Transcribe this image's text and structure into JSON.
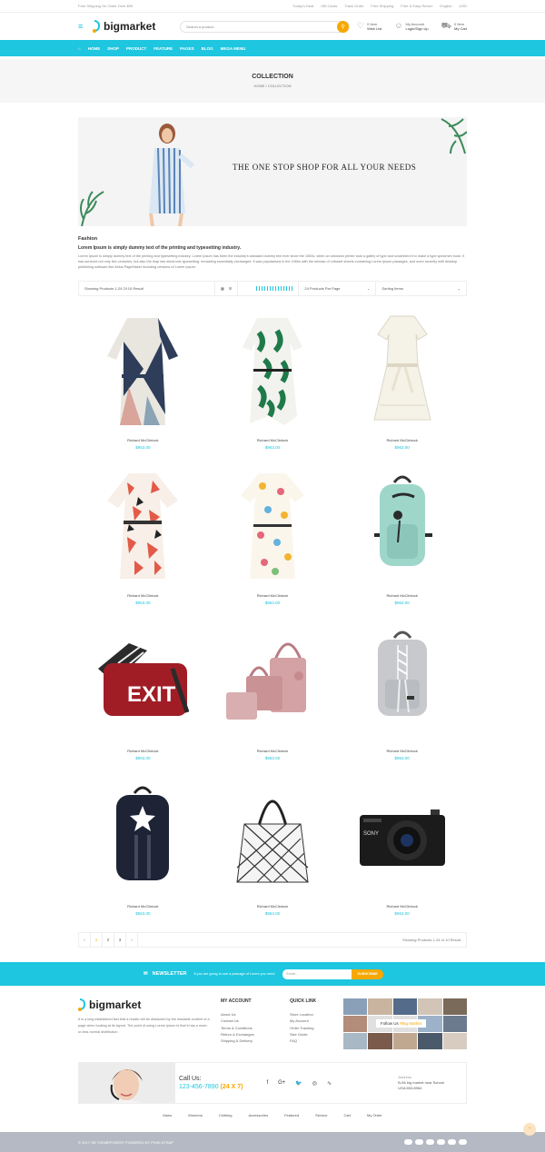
{
  "topbar": {
    "shipping": "Free Shipping On Order Over $99",
    "links": [
      "Today's Deal",
      "Gift Cards",
      "Track Order",
      "Free Shipping",
      "Free & Easy Return",
      "English",
      "USD"
    ]
  },
  "header": {
    "logo": "bigmarket",
    "search_placeholder": "Search a product",
    "wishlist_count": "0 Item",
    "wishlist_label": "Wish List",
    "account_label": "My Account",
    "account_action": "Login/Sign Up",
    "cart_count": "0 Item",
    "cart_label": "My Cart"
  },
  "nav": [
    "HOME",
    "SHOP",
    "PRODUCT",
    "FEATURE",
    "PAGES",
    "BLOG",
    "MEGA MENU"
  ],
  "page": {
    "title": "COLLECTION",
    "breadcrumb_home": "HOME",
    "breadcrumb_sep": "/",
    "breadcrumb_current": "COLLECTION"
  },
  "hero": {
    "tagline": "THE ONE STOP SHOP FOR ALL YOUR NEEDS"
  },
  "category": {
    "name": "Fashion",
    "subtitle": "Lorem Ipsum is simply dummy text of the printing and typesetting industry.",
    "description": "Lorem Ipsum is simply dummy text of the printing and typesetting industry. Lorem Ipsum has been the industry's standard dummy text ever since the 1500s, when an unknown printer took a galley of type and scrambled it to make a type specimen book. It has survived not only five centuries, but also the leap into electronic typesetting, remaining essentially unchanged. It was popularised in the 1960s with the release of Letraset sheets containing Lorem Ipsum passages, and more recently with desktop publishing software like Aldus PageMaker including versions of Lorem Ipsum."
  },
  "toolbar": {
    "showing": "Showing Products 1-24 Of 10 Result",
    "per_page": "24 Products Par Page",
    "sorting": "Sorting Items"
  },
  "products": [
    {
      "name": "Richard McClintock",
      "price": "$963.00",
      "image": "dress-geometric"
    },
    {
      "name": "Richard McClintock",
      "price": "$963.00",
      "image": "dress-leaf"
    },
    {
      "name": "Richard McClintock",
      "price": "$963.00",
      "image": "dress-white"
    },
    {
      "name": "Richard McClintock",
      "price": "$963.00",
      "image": "dress-floral"
    },
    {
      "name": "Richard McClintock",
      "price": "$963.00",
      "image": "dress-print"
    },
    {
      "name": "Richard McClintock",
      "price": "$963.00",
      "image": "backpack-mint"
    },
    {
      "name": "Richard McClintock",
      "price": "$963.00",
      "image": "bag-exit"
    },
    {
      "name": "Richard McClintock",
      "price": "$963.00",
      "image": "handbag-pink"
    },
    {
      "name": "Richard McClintock",
      "price": "$963.00",
      "image": "backpack-grey"
    },
    {
      "name": "Richard McClintock",
      "price": "$963.00",
      "image": "backpack-navy"
    },
    {
      "name": "Richard McClintock",
      "price": "$963.00",
      "image": "tote-geometric"
    },
    {
      "name": "Richard McClintock",
      "price": "$963.00",
      "image": "camera-sony"
    }
  ],
  "pagination": {
    "prev": "‹",
    "pages": [
      "1",
      "2",
      "3"
    ],
    "next": "›",
    "info": "Showing Products 1-24 of 10 Result"
  },
  "newsletter": {
    "title": "NEWSLETTER",
    "desc": "If you are going to use a passage of Lorem you need.",
    "placeholder": "Email...",
    "button": "SUBSCRIBE"
  },
  "footer": {
    "about": "It is a long established fact that a reader will be distracted by the readable content of a page when looking at its layout. The point of using Lorem Ipsum is that it has a more-or-less normal distribution",
    "account_title": "MY ACCOUNT",
    "account_links": [
      "About Us",
      "Contact Us",
      "Terms & Conditions",
      "Return & Exchanges",
      "Shipping & Delivery"
    ],
    "quick_title": "QUICK LINK",
    "quick_links": [
      "Store Location",
      "My Account",
      "Order Tracking",
      "Size Guide",
      "FAQ"
    ],
    "follow_label": "Follow Us",
    "follow_handle": "#Big Market",
    "call_label": "Call Us:",
    "phone": "123-456-7890",
    "phone_hours": "(24 X 7)",
    "address_label": "Address",
    "address_1": "B-56 big market near School",
    "address_2": "USA 653-8964",
    "links": [
      "Mans",
      "Womens",
      "Clothing",
      "Accessories",
      "Featured",
      "Service",
      "Cart",
      "My Order"
    ],
    "copyright": "© 2017 GB THEMEFOREST POWERED BY PIXELSTRAP"
  },
  "colors": {
    "accent": "#1ec6df",
    "highlight": "#f7a800"
  }
}
